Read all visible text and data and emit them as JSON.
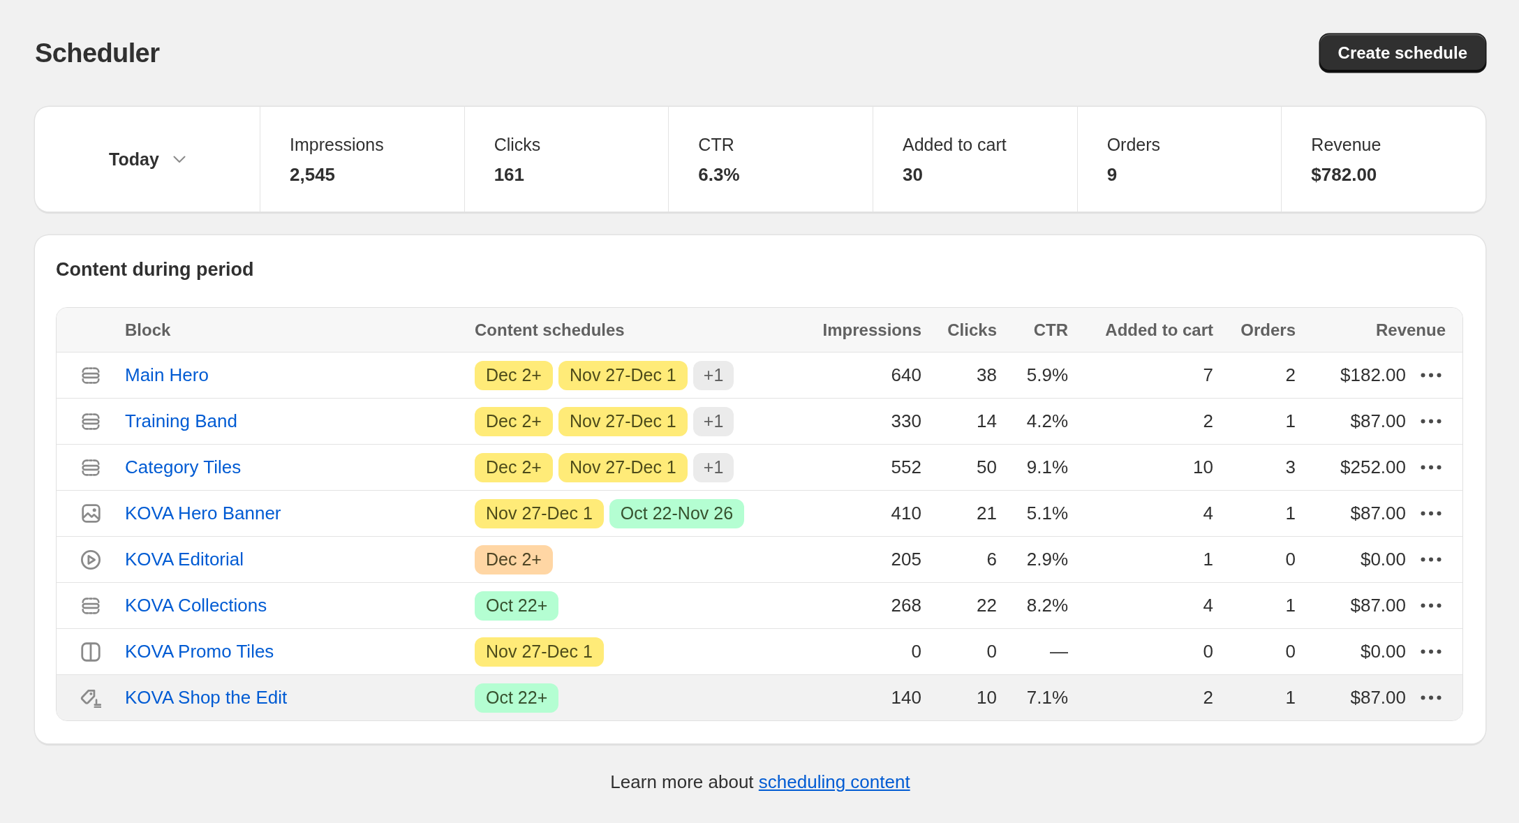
{
  "page": {
    "title": "Scheduler",
    "primary_action": "Create schedule"
  },
  "summary": {
    "period": "Today",
    "metrics": [
      {
        "label": "Impressions",
        "value": "2,545"
      },
      {
        "label": "Clicks",
        "value": "161"
      },
      {
        "label": "CTR",
        "value": "6.3%"
      },
      {
        "label": "Added to cart",
        "value": "30"
      },
      {
        "label": "Orders",
        "value": "9"
      },
      {
        "label": "Revenue",
        "value": "$782.00"
      }
    ]
  },
  "content": {
    "title": "Content during period",
    "table": {
      "columns": [
        "Block",
        "Content schedules",
        "Impressions",
        "Clicks",
        "CTR",
        "Added to cart",
        "Orders",
        "Revenue"
      ],
      "rows": [
        {
          "kind": "section",
          "block": "Main Hero",
          "schedules": [
            {
              "text": "Dec 2+",
              "color": "#ffeb78"
            },
            {
              "text": "Nov 27-Dec 1",
              "color": "#ffeb78"
            }
          ],
          "more": "+1",
          "impressions": "640",
          "clicks": "38",
          "ctr": "5.9%",
          "added_to_cart": "7",
          "orders": "2",
          "revenue": "$182.00",
          "hovered": false
        },
        {
          "kind": "section",
          "block": "Training Band",
          "schedules": [
            {
              "text": "Dec 2+",
              "color": "#ffeb78"
            },
            {
              "text": "Nov 27-Dec 1",
              "color": "#ffeb78"
            }
          ],
          "more": "+1",
          "impressions": "330",
          "clicks": "14",
          "ctr": "4.2%",
          "added_to_cart": "2",
          "orders": "1",
          "revenue": "$87.00",
          "hovered": false
        },
        {
          "kind": "section",
          "block": "Category Tiles",
          "schedules": [
            {
              "text": "Dec 2+",
              "color": "#ffeb78"
            },
            {
              "text": "Nov 27-Dec 1",
              "color": "#ffeb78"
            }
          ],
          "more": "+1",
          "impressions": "552",
          "clicks": "50",
          "ctr": "9.1%",
          "added_to_cart": "10",
          "orders": "3",
          "revenue": "$252.00",
          "hovered": false
        },
        {
          "kind": "image",
          "block": "KOVA Hero Banner",
          "schedules": [
            {
              "text": "Nov 27-Dec 1",
              "color": "#ffeb78"
            },
            {
              "text": "Oct 22-Nov 26",
              "color": "#b4fed2"
            }
          ],
          "impressions": "410",
          "clicks": "21",
          "ctr": "5.1%",
          "added_to_cart": "4",
          "orders": "1",
          "revenue": "$87.00",
          "hovered": false
        },
        {
          "kind": "video",
          "block": "KOVA Editorial",
          "schedules": [
            {
              "text": "Dec 2+",
              "color": "#ffd6a4"
            }
          ],
          "impressions": "205",
          "clicks": "6",
          "ctr": "2.9%",
          "added_to_cart": "1",
          "orders": "0",
          "revenue": "$0.00",
          "hovered": false
        },
        {
          "kind": "section",
          "block": "KOVA Collections",
          "schedules": [
            {
              "text": "Oct 22+",
              "color": "#b4fed2"
            }
          ],
          "impressions": "268",
          "clicks": "22",
          "ctr": "8.2%",
          "added_to_cart": "4",
          "orders": "1",
          "revenue": "$87.00",
          "hovered": false
        },
        {
          "kind": "columns",
          "block": "KOVA Promo Tiles",
          "schedules": [
            {
              "text": "Nov 27-Dec 1",
              "color": "#ffeb78"
            }
          ],
          "impressions": "0",
          "clicks": "0",
          "ctr": "—",
          "added_to_cart": "0",
          "orders": "0",
          "revenue": "$0.00",
          "hovered": false
        },
        {
          "kind": "product",
          "block": "KOVA Shop the Edit",
          "schedules": [
            {
              "text": "Oct 22+",
              "color": "#b4fed2"
            }
          ],
          "impressions": "140",
          "clicks": "10",
          "ctr": "7.1%",
          "added_to_cart": "2",
          "orders": "1",
          "revenue": "$87.00",
          "hovered": true
        }
      ]
    }
  },
  "footer": {
    "text": "Learn more about",
    "link": "scheduling content"
  }
}
